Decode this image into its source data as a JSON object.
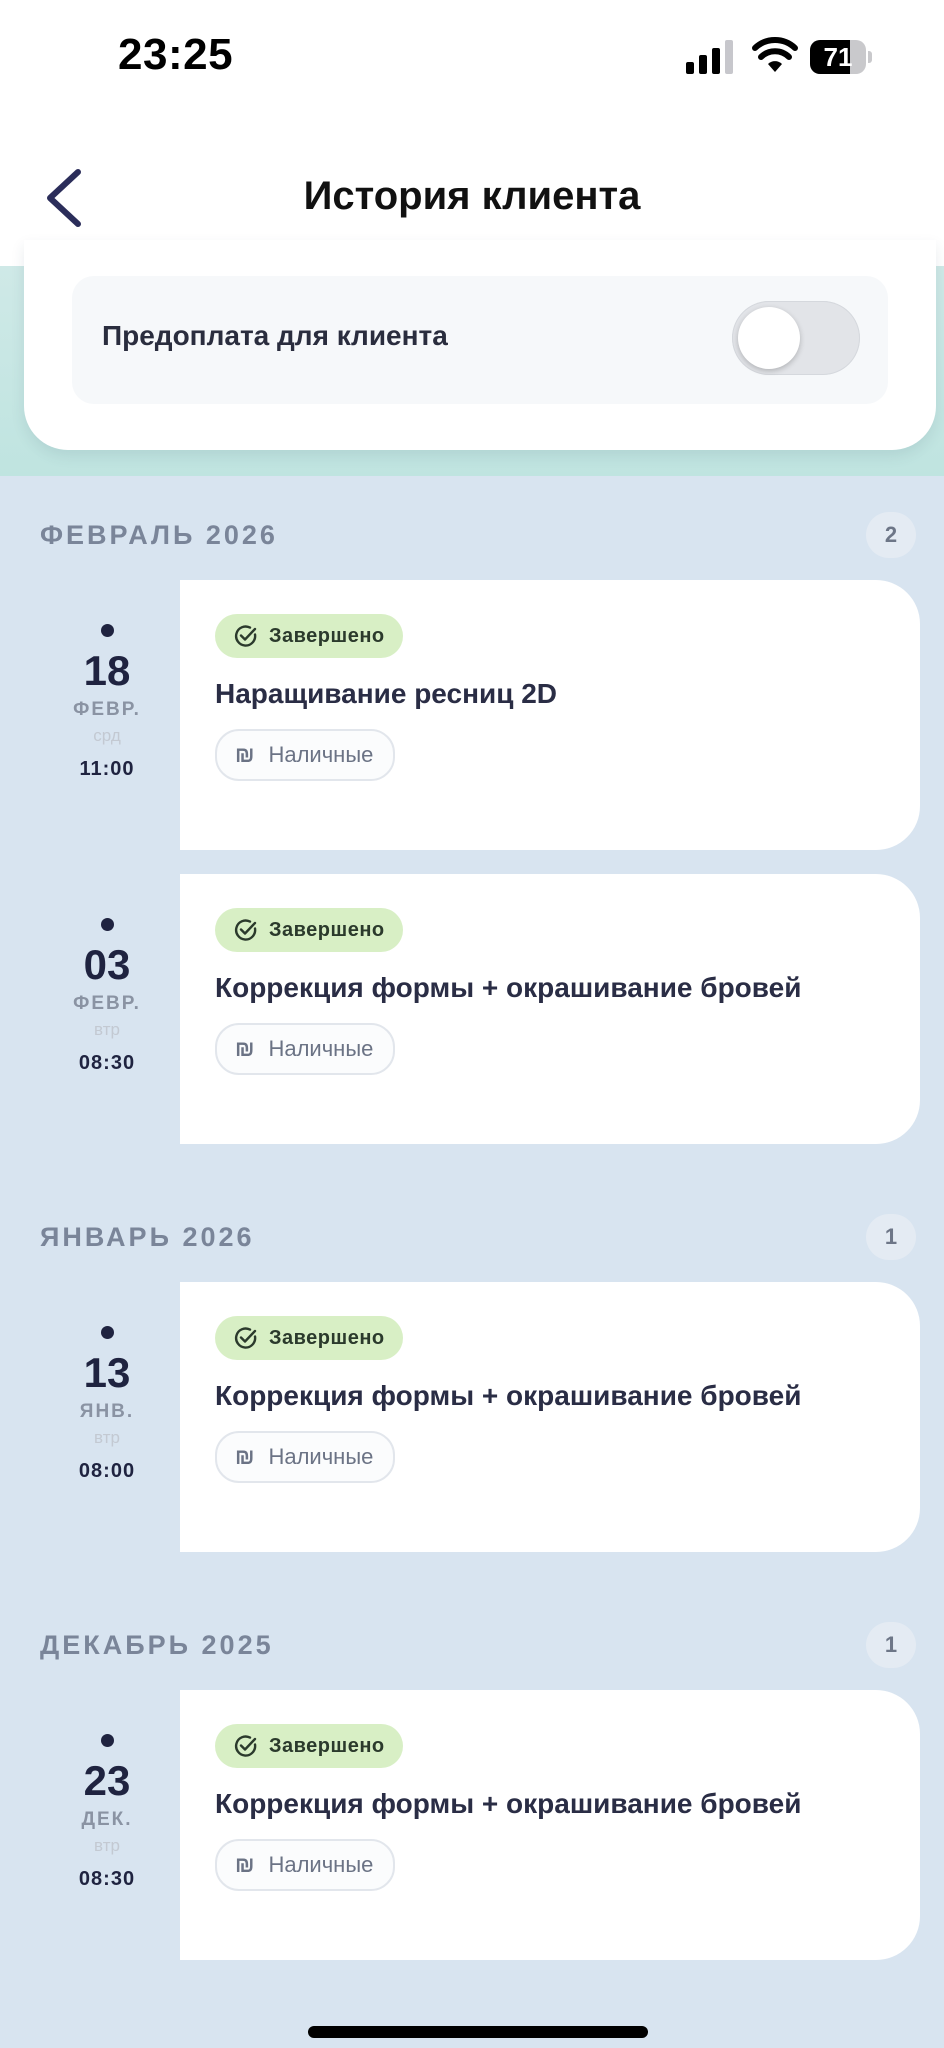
{
  "status_bar": {
    "time": "23:25",
    "battery": "71",
    "battery_level": 0.71
  },
  "header": {
    "title": "История клиента"
  },
  "settings": {
    "prepay_label": "Предоплата для клиента",
    "prepay_enabled": false
  },
  "sections": [
    {
      "label": "ФЕВРАЛЬ 2026",
      "count": "2",
      "items": [
        {
          "day": "18",
          "month": "ФЕВР.",
          "weekday": "срд",
          "time": "11:00",
          "status": "Завершено",
          "service": "Наращивание ресниц 2D",
          "payment_icon": "₪",
          "payment": "Наличные"
        },
        {
          "day": "03",
          "month": "ФЕВР.",
          "weekday": "втр",
          "time": "08:30",
          "status": "Завершено",
          "service": "Коррекция формы + окрашивание бровей",
          "payment_icon": "₪",
          "payment": "Наличные"
        }
      ]
    },
    {
      "label": "ЯНВАРЬ 2026",
      "count": "1",
      "items": [
        {
          "day": "13",
          "month": "ЯНВ.",
          "weekday": "втр",
          "time": "08:00",
          "status": "Завершено",
          "service": "Коррекция формы + окрашивание бровей",
          "payment_icon": "₪",
          "payment": "Наличные"
        }
      ]
    },
    {
      "label": "ДЕКАБРЬ 2025",
      "count": "1",
      "items": [
        {
          "day": "23",
          "month": "ДЕК.",
          "weekday": "втр",
          "time": "08:30",
          "status": "Завершено",
          "service": "Коррекция формы + окрашивание бровей",
          "payment_icon": "₪",
          "payment": "Наличные"
        }
      ]
    }
  ],
  "colors": {
    "page_bg": "#d8e4f0",
    "status_completed_bg": "#d8efc5",
    "accent_dark": "#1f2340"
  }
}
